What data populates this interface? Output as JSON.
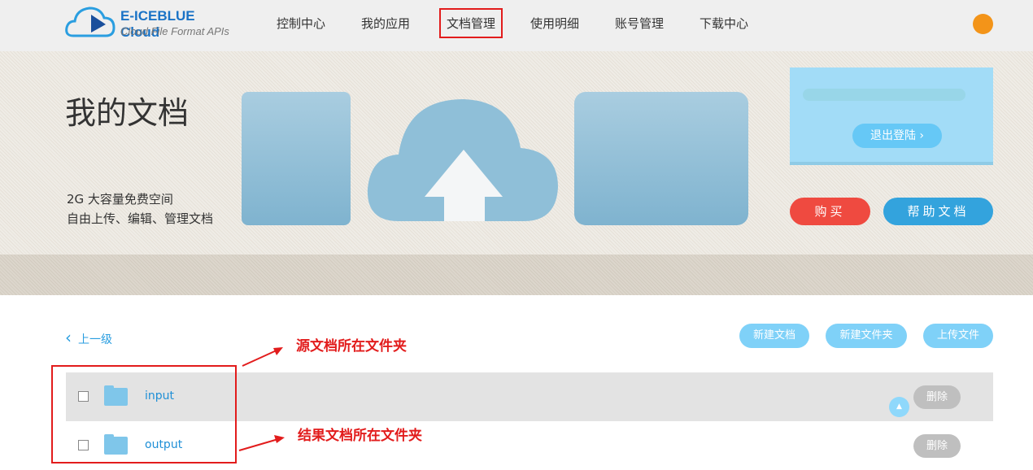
{
  "header": {
    "logo_title": "E-ICEBLUE Cloud",
    "logo_subtitle": "Cloud File Format APIs",
    "nav": [
      "控制中心",
      "我的应用",
      "文档管理",
      "使用明细",
      "账号管理",
      "下载中心"
    ],
    "active_nav": "文档管理"
  },
  "banner": {
    "title": "我的文档",
    "slogan_line1": "2G 大容量免费空间",
    "slogan_line2": "自由上传、编辑、管理文档",
    "logout_label": "退出登陆 ›",
    "buy_label": "购买",
    "help_label": "帮助文档"
  },
  "toolbar": {
    "back_label": "上一级",
    "new_doc": "新建文档",
    "new_folder": "新建文件夹",
    "upload": "上传文件"
  },
  "files": [
    {
      "name": "input",
      "delete_label": "删除"
    },
    {
      "name": "output",
      "delete_label": "删除"
    }
  ],
  "annotations": {
    "source_folder": "源文档所在文件夹",
    "result_folder": "结果文档所在文件夹"
  },
  "colors": {
    "accent": "#33a3dd",
    "buy": "#ef4a40",
    "annotation": "#e21c1c"
  }
}
